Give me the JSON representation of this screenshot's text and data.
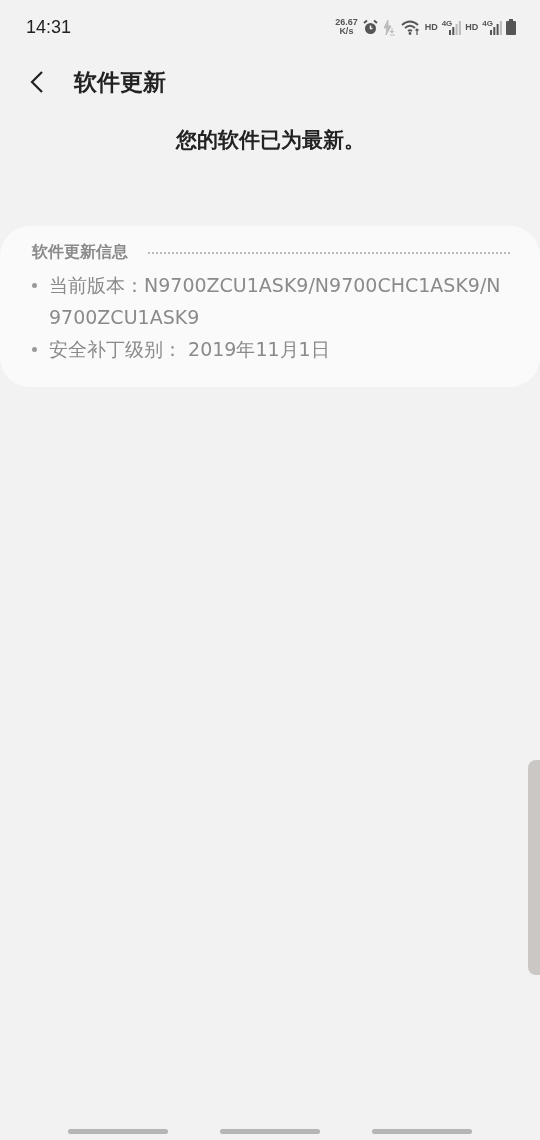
{
  "status_bar": {
    "time": "14:31",
    "speed_value": "26.67",
    "speed_unit": "K/s",
    "sim1_hd": "HD",
    "sim1_net": "4G",
    "sim2_hd": "HD",
    "sim2_net": "4G"
  },
  "header": {
    "title": "软件更新"
  },
  "message": "您的软件已为最新。",
  "info_card": {
    "title": "软件更新信息",
    "items": [
      "当前版本：N9700ZCU1ASK9/N9700CHC1ASK9/N9700ZCU1ASK9",
      "安全补丁级别： 2019年11月1日"
    ]
  }
}
